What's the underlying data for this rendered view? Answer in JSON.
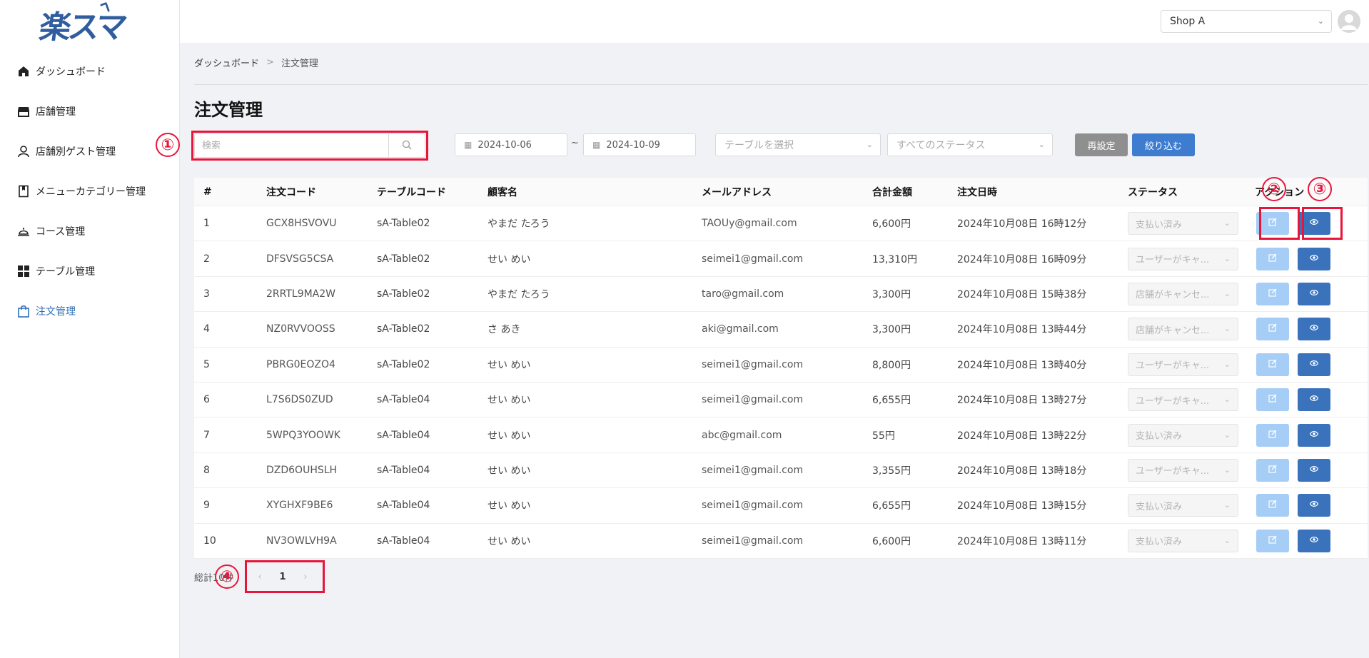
{
  "logo": {
    "text": "楽スマ"
  },
  "sidebar": {
    "items": [
      {
        "label": "ダッシュボード",
        "icon": "home-icon"
      },
      {
        "label": "店舗管理",
        "icon": "store-icon"
      },
      {
        "label": "店舗別ゲスト管理",
        "icon": "user-icon"
      },
      {
        "label": "メニューカテゴリー管理",
        "icon": "book-icon"
      },
      {
        "label": "コース管理",
        "icon": "cloche-icon"
      },
      {
        "label": "テーブル管理",
        "icon": "grid-icon"
      },
      {
        "label": "注文管理",
        "icon": "bag-icon",
        "active": true
      }
    ]
  },
  "header": {
    "shop_select": "Shop A"
  },
  "breadcrumb": {
    "home": "ダッシュボード",
    "sep": ">",
    "current": "注文管理"
  },
  "page_title": "注文管理",
  "filters": {
    "search_placeholder": "検索",
    "date_from": "2024-10-06",
    "date_tilde": "~",
    "date_to": "2024-10-09",
    "table_placeholder": "テーブルを選択",
    "status_placeholder": "すべてのステータス",
    "reset_label": "再設定",
    "filter_label": "絞り込む"
  },
  "table": {
    "headers": [
      "#",
      "注文コード",
      "テーブルコード",
      "顧客名",
      "メールアドレス",
      "合計金額",
      "注文日時",
      "ステータス",
      "アクション"
    ],
    "rows": [
      [
        "1",
        "GCX8HSVOVU",
        "sA-Table02",
        "やまだ たろう",
        "TAOUy@gmail.com",
        "6,600円",
        "2024年10月08日 16時12分",
        "支払い済み"
      ],
      [
        "2",
        "DFSVSG5CSA",
        "sA-Table02",
        "せい めい",
        "seimei1@gmail.com",
        "13,310円",
        "2024年10月08日 16時09分",
        "ユーザーがキャ..."
      ],
      [
        "3",
        "2RRTL9MA2W",
        "sA-Table02",
        "やまだ たろう",
        "taro@gmail.com",
        "3,300円",
        "2024年10月08日 15時38分",
        "店舗がキャンセ..."
      ],
      [
        "4",
        "NZ0RVVOOSS",
        "sA-Table02",
        "さ あき",
        "aki@gmail.com",
        "3,300円",
        "2024年10月08日 13時44分",
        "店舗がキャンセ..."
      ],
      [
        "5",
        "PBRG0EOZO4",
        "sA-Table02",
        "せい めい",
        "seimei1@gmail.com",
        "8,800円",
        "2024年10月08日 13時40分",
        "ユーザーがキャ..."
      ],
      [
        "6",
        "L7S6DS0ZUD",
        "sA-Table04",
        "せい めい",
        "seimei1@gmail.com",
        "6,655円",
        "2024年10月08日 13時27分",
        "ユーザーがキャ..."
      ],
      [
        "7",
        "5WPQ3YOOWK",
        "sA-Table04",
        "せい めい",
        "abc@gmail.com",
        "55円",
        "2024年10月08日 13時22分",
        "支払い済み"
      ],
      [
        "8",
        "DZD6OUHSLH",
        "sA-Table04",
        "せい めい",
        "seimei1@gmail.com",
        "3,355円",
        "2024年10月08日 13時18分",
        "ユーザーがキャ..."
      ],
      [
        "9",
        "XYGHXF9BE6",
        "sA-Table04",
        "せい めい",
        "seimei1@gmail.com",
        "6,655円",
        "2024年10月08日 13時15分",
        "支払い済み"
      ],
      [
        "10",
        "NV3OWLVH9A",
        "sA-Table04",
        "せい めい",
        "seimei1@gmail.com",
        "6,600円",
        "2024年10月08日 13時11分",
        "支払い済み"
      ]
    ]
  },
  "pagination": {
    "total_label": "総計10件",
    "prev": "‹",
    "current": "1",
    "next": "›"
  },
  "annotations": [
    "①",
    "②",
    "③",
    "④"
  ],
  "colors": {
    "accent": "#3a72bb",
    "highlight": "#e8153a",
    "edit_button": "#a6cdf5",
    "reset_button": "#8f8f8f",
    "filter_button": "#3d7ccf"
  }
}
